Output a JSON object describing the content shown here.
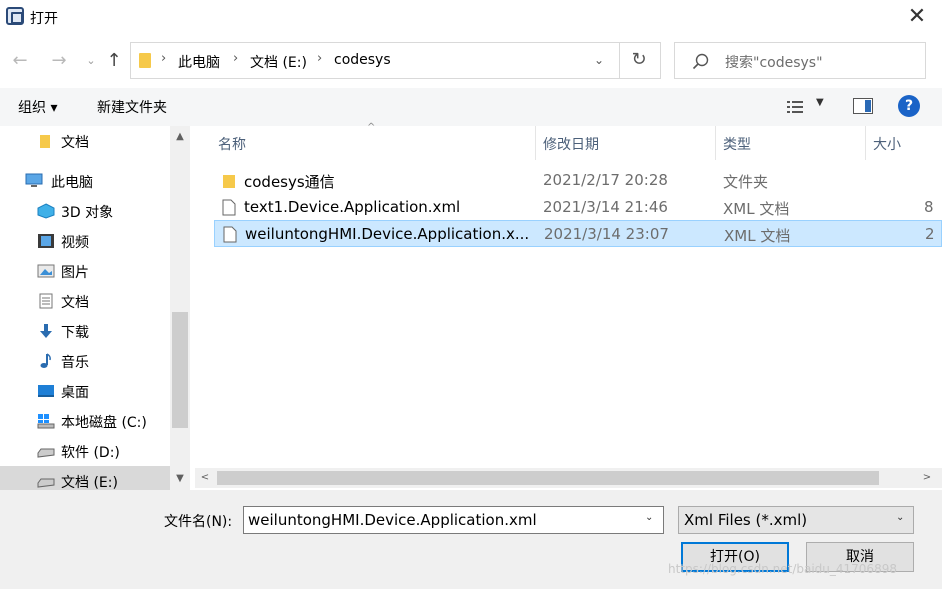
{
  "window": {
    "title": "打开",
    "close_glyph": "✕"
  },
  "nav": {
    "back_glyph": "←",
    "forward_glyph": "→",
    "recent_glyph": "⌄",
    "up_glyph": "↑",
    "breadcrumbs": [
      "此电脑",
      "文档 (E:)",
      "codesys"
    ],
    "separator": "›",
    "dropdown_glyph": "⌄",
    "refresh_glyph": "↻"
  },
  "search": {
    "placeholder": "搜索\"codesys\""
  },
  "toolbar": {
    "organize_label": "组织 ▾",
    "new_folder_label": "新建文件夹",
    "view_dropdown_glyph": "▼",
    "help_label": "?"
  },
  "sidebar": {
    "items": [
      {
        "label": "文档",
        "icon": "folder-icon"
      },
      {
        "label": "此电脑",
        "icon": "computer-icon"
      },
      {
        "label": "3D 对象",
        "icon": "3d-objects-icon"
      },
      {
        "label": "视频",
        "icon": "video-icon"
      },
      {
        "label": "图片",
        "icon": "pictures-icon"
      },
      {
        "label": "文档",
        "icon": "documents-icon"
      },
      {
        "label": "下载",
        "icon": "download-icon"
      },
      {
        "label": "音乐",
        "icon": "music-icon"
      },
      {
        "label": "桌面",
        "icon": "desktop-icon"
      },
      {
        "label": "本地磁盘 (C:)",
        "icon": "drive-c-icon"
      },
      {
        "label": "软件 (D:)",
        "icon": "drive-icon"
      },
      {
        "label": "文档 (E:)",
        "icon": "drive-icon"
      }
    ],
    "selected_index": 11,
    "scroll_up_glyph": "▲",
    "scroll_down_glyph": "▼"
  },
  "filelist": {
    "columns": [
      "名称",
      "修改日期",
      "类型",
      "大小"
    ],
    "sort_glyph": "^",
    "rows": [
      {
        "name": "codesys通信",
        "date": "2021/2/17 20:28",
        "type": "文件夹",
        "size": "",
        "icon": "folder-icon"
      },
      {
        "name": "text1.Device.Application.xml",
        "date": "2021/3/14 21:46",
        "type": "XML 文档",
        "size": "8",
        "icon": "file-icon"
      },
      {
        "name": "weiluntongHMI.Device.Application.x...",
        "date": "2021/3/14 23:07",
        "type": "XML 文档",
        "size": "2",
        "icon": "file-icon"
      }
    ],
    "selected_index": 2,
    "hscroll_left_glyph": "<",
    "hscroll_right_glyph": ">"
  },
  "footer": {
    "filename_label": "文件名(N):",
    "filename_value": "weiluntongHMI.Device.Application.xml",
    "filetype_value": "Xml Files (*.xml)",
    "dropdown_glyph": "⌄",
    "open_label": "打开(O)",
    "cancel_label": "取消",
    "watermark": "https://blog.csdn.net/baidu_41706898"
  },
  "colors": {
    "selection_bg": "#cce8ff",
    "selection_border": "#99d1ff",
    "accent": "#0078d7",
    "folder": "#f6c94a"
  }
}
